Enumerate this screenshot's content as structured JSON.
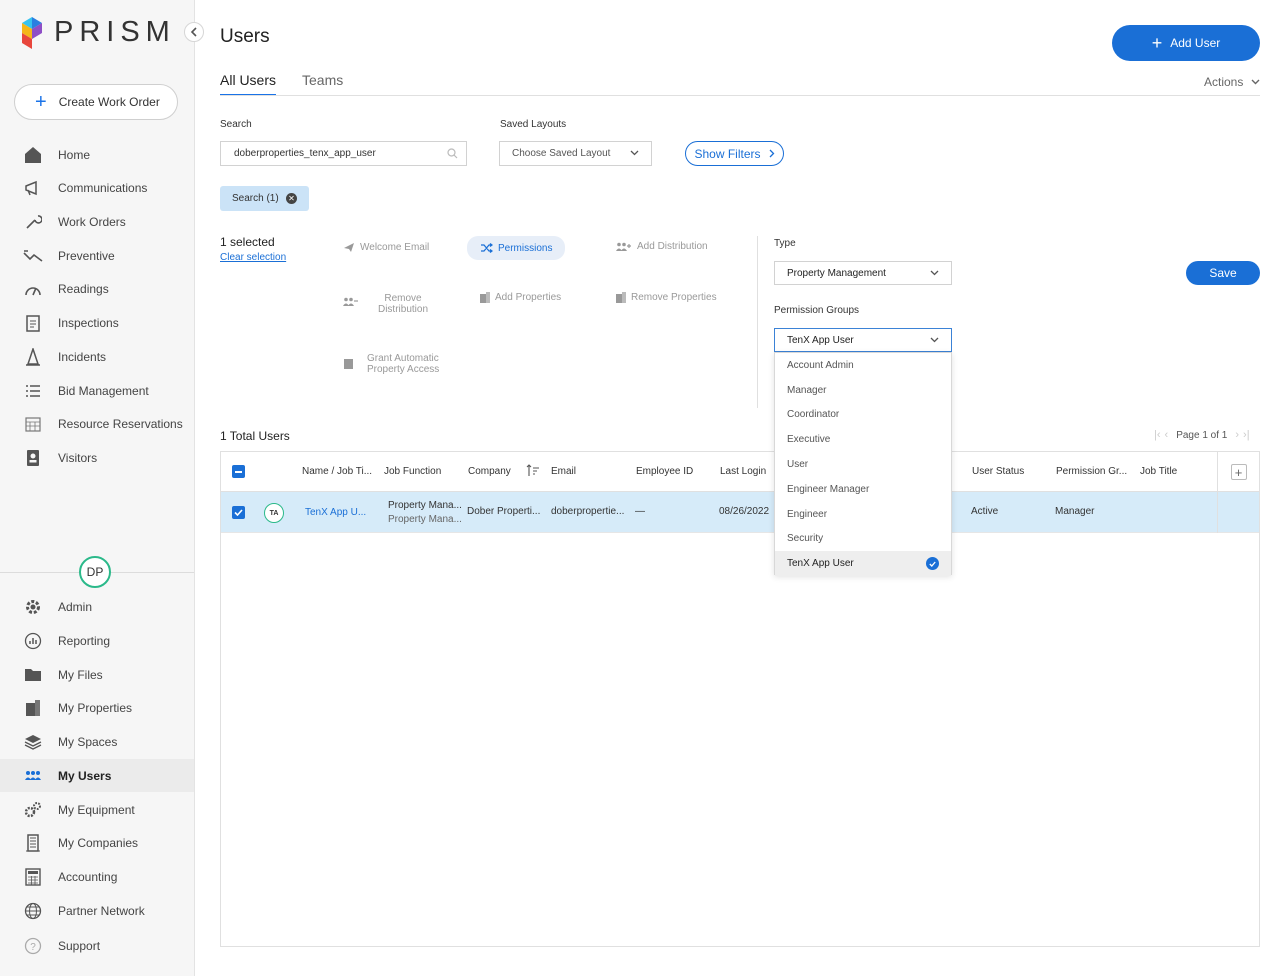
{
  "brand": {
    "name": "PRISM"
  },
  "sidebar": {
    "create_label": "Create Work Order",
    "items_top": [
      {
        "label": "Home",
        "icon": "home-icon"
      },
      {
        "label": "Communications",
        "icon": "megaphone-icon"
      },
      {
        "label": "Work Orders",
        "icon": "wrench-icon"
      },
      {
        "label": "Preventive",
        "icon": "preventive-icon"
      },
      {
        "label": "Readings",
        "icon": "gauge-icon"
      },
      {
        "label": "Inspections",
        "icon": "clipboard-icon"
      },
      {
        "label": "Incidents",
        "icon": "cone-icon"
      },
      {
        "label": "Bid Management",
        "icon": "list-icon"
      },
      {
        "label": "Resource Reservations",
        "icon": "calendar-icon"
      },
      {
        "label": "Visitors",
        "icon": "badge-icon"
      }
    ],
    "user_initials": "DP",
    "items_bottom": [
      {
        "label": "Admin",
        "icon": "gear-icon"
      },
      {
        "label": "Reporting",
        "icon": "chart-icon"
      },
      {
        "label": "My Files",
        "icon": "folder-icon"
      },
      {
        "label": "My Properties",
        "icon": "building-icon"
      },
      {
        "label": "My Spaces",
        "icon": "layers-icon"
      },
      {
        "label": "My Users",
        "icon": "users-icon"
      },
      {
        "label": "My Equipment",
        "icon": "gears-icon"
      },
      {
        "label": "My Companies",
        "icon": "company-icon"
      },
      {
        "label": "Accounting",
        "icon": "calculator-icon"
      },
      {
        "label": "Partner Network",
        "icon": "globe-icon"
      },
      {
        "label": "Support",
        "icon": "help-icon"
      }
    ],
    "active_item": "My Users"
  },
  "header": {
    "title": "Users",
    "add_user_label": "Add User",
    "tabs": [
      {
        "label": "All Users",
        "active": true
      },
      {
        "label": "Teams",
        "active": false
      }
    ],
    "actions_label": "Actions"
  },
  "filters": {
    "search_label": "Search",
    "search_value": "doberproperties_tenx_app_user",
    "saved_layouts_label": "Saved Layouts",
    "saved_layouts_placeholder": "Choose Saved Layout",
    "show_filters_label": "Show Filters",
    "chip_label": "Search (1)"
  },
  "bulk": {
    "selected_text": "1 selected",
    "clear_label": "Clear selection",
    "actions": [
      {
        "label": "Welcome Email"
      },
      {
        "label": "Permissions"
      },
      {
        "label": "Add Distribution"
      },
      {
        "label": "Remove Distribution"
      },
      {
        "label": "Add Properties"
      },
      {
        "label": "Remove Properties"
      },
      {
        "label": "Grant Automatic Property Access"
      }
    ],
    "type_label": "Type",
    "type_value": "Property Management",
    "perm_groups_label": "Permission Groups",
    "perm_groups_value": "TenX App User",
    "perm_options": [
      "Account Admin",
      "Manager",
      "Coordinator",
      "Executive",
      "User",
      "Engineer Manager",
      "Engineer",
      "Security",
      "TenX App User"
    ],
    "perm_selected": "TenX App User",
    "save_label": "Save"
  },
  "table": {
    "total_text": "1 Total Users",
    "pager_text": "Page 1 of 1",
    "columns": [
      "Name / Job Ti...",
      "Job Function",
      "Company",
      "Email",
      "Employee ID",
      "Last Login",
      "User Status",
      "Permission Gr...",
      "Job Title"
    ],
    "rows": [
      {
        "initials": "TA",
        "name": "TenX App U...",
        "job_function_1": "Property Mana...",
        "job_function_2": "Property Mana...",
        "company": "Dober Properti...",
        "email": "doberpropertie...",
        "employee_id": "—",
        "last_login": "08/26/2022",
        "status": "Active",
        "permission_group": "Manager",
        "job_title": ""
      }
    ]
  },
  "colors": {
    "accent": "#1a6fd6",
    "selected_row": "#d6ebf9",
    "avatar_ring": "#2bb98a"
  }
}
